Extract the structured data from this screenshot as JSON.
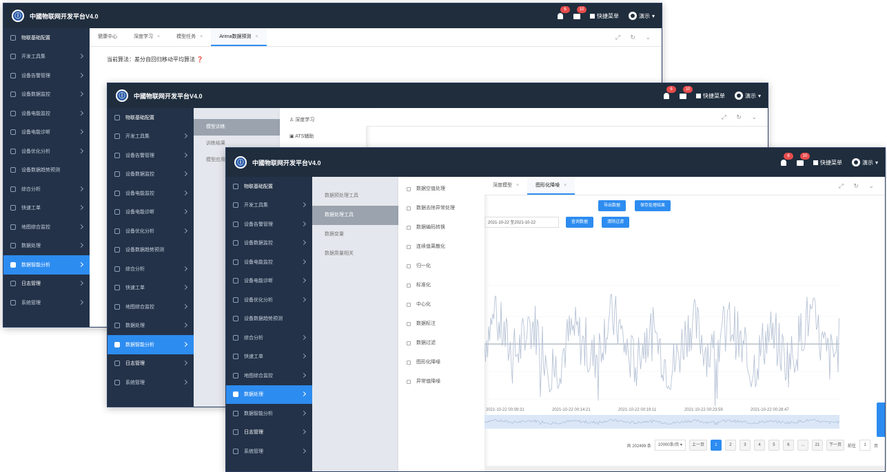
{
  "app_title": "中國物联网开发平台V4.0",
  "header": {
    "badge_bell": "6",
    "badge_msg": "10",
    "quick_label": "快捷菜单",
    "user_label": "演示"
  },
  "sidebar_items": [
    "物联基础配置",
    "开发工具集",
    "设备告警管理",
    "设备数据监控",
    "设备电能监控",
    "设备电能诊断",
    "设备优化分析",
    "设备数据趋势预测",
    "综合分析",
    "快速工单",
    "地图综合监控",
    "数据处理",
    "数据智能分析",
    "日志管理",
    "系统管理"
  ],
  "win1": {
    "tabs": [
      "健康中心",
      "深度学习",
      "模型任务",
      "Arima数据预测"
    ],
    "subtitle": "当前算法：差分自回归移动平均算法"
  },
  "win2": {
    "sub1": [
      "模型训练",
      "训练结果",
      "模型应用"
    ],
    "sub2": [
      "深度学习",
      "ATS辅助"
    ]
  },
  "win3": {
    "sub1": [
      "数据预处理工具",
      "数据处理工具",
      "数据变量",
      "数据质量相关"
    ],
    "sub2": [
      "数据空值处理",
      "数据去除异常处理",
      "数据编码转换",
      "连续值离散化",
      "归一化",
      "标准化",
      "中心化",
      "数据标注",
      "数据过滤",
      "图形化降噪",
      "异常值降噪"
    ],
    "tabs": [
      "深度模型",
      "图形化降噪"
    ],
    "buttons": {
      "export": "导出数据",
      "save": "保存处理结果",
      "query": "查询数据",
      "reset": "清除过滤"
    },
    "date_value": "2021-10-22 至2021-10-22",
    "x_ticks": [
      "2021-10-22 00:09:31",
      "2021-10-22 00:14:21",
      "2021-10-22 00:19:11",
      "2021-10-22 00:23:59",
      "2021-10-22 00:28:47"
    ],
    "pager": {
      "total": "共 202499 条",
      "size": "10000条/页",
      "prev": "上一页",
      "pages": [
        "1",
        "2",
        "3",
        "4",
        "5",
        "6",
        "...",
        "21"
      ],
      "next": "下一页",
      "goto": "前往",
      "page_input": "1",
      "page_suffix": "页"
    }
  },
  "colors": {
    "topbar": "#1f2d3d",
    "sidebar": "#233248",
    "accent": "#2d8cf0",
    "series": "#b7c3d6"
  }
}
